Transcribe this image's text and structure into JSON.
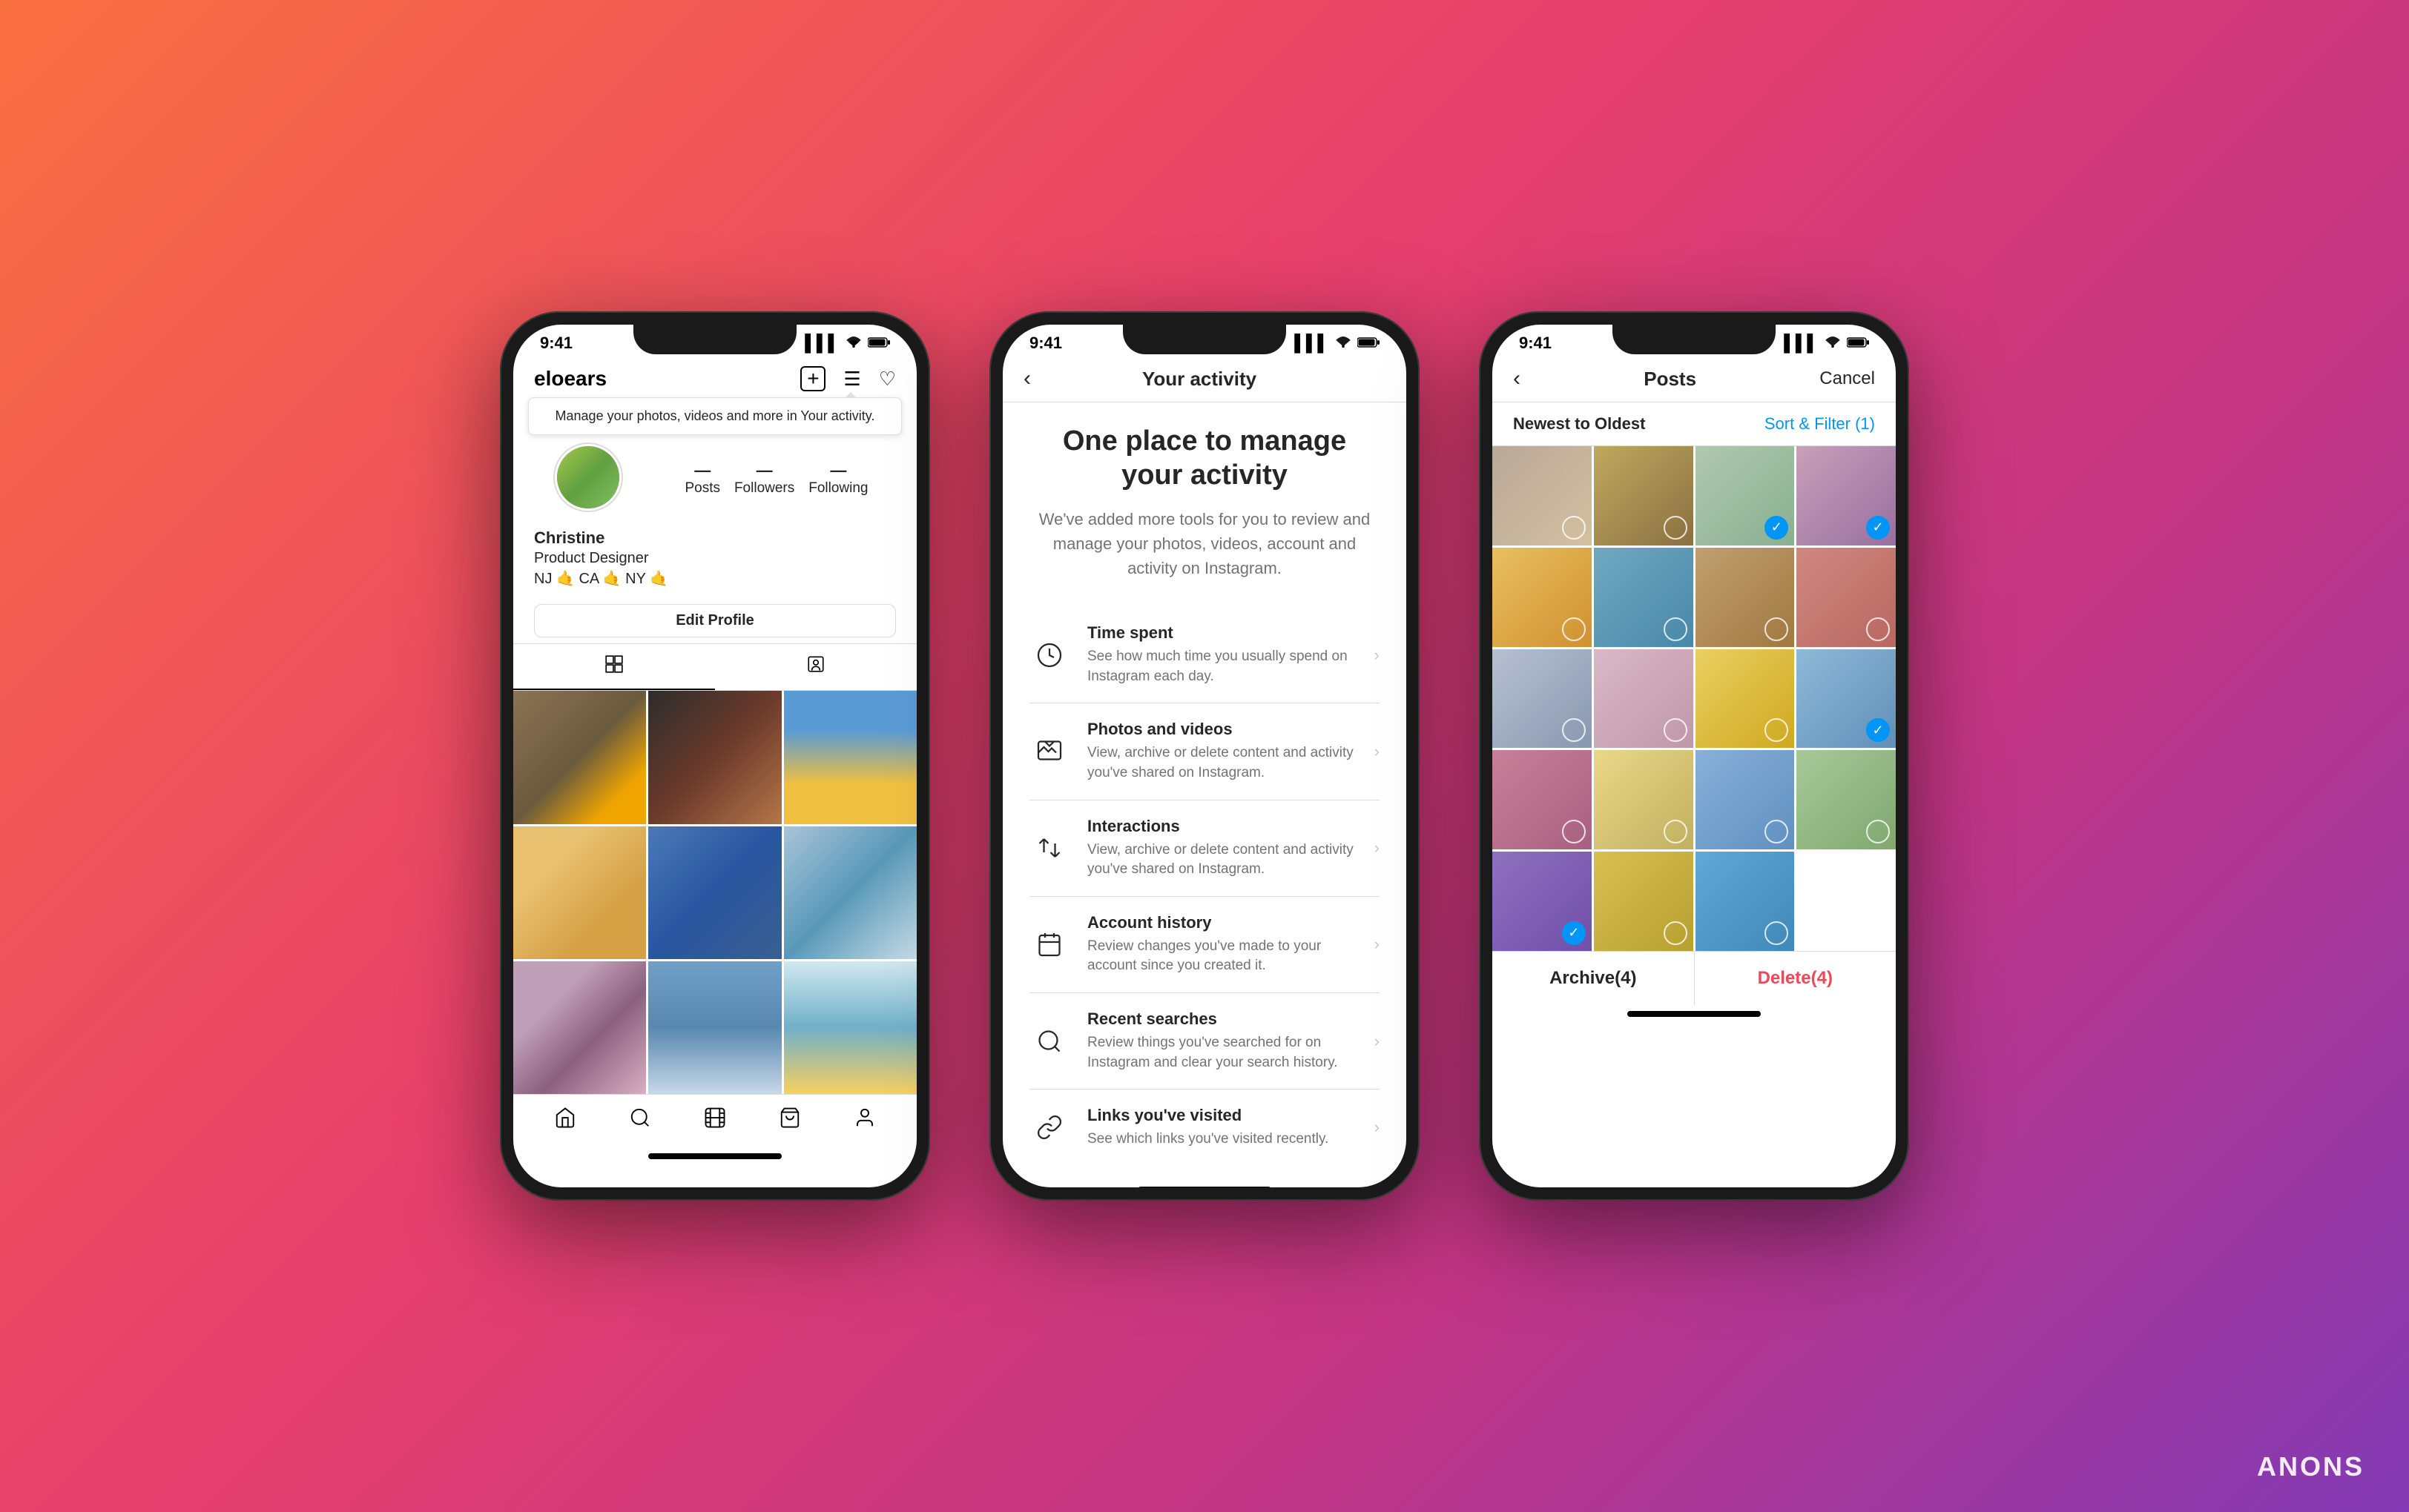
{
  "background": {
    "gradient": "linear-gradient(135deg, #f97040, #e8406c, #c13584, #833ab4)"
  },
  "watermark": {
    "text": "ANONS"
  },
  "phone1": {
    "status": {
      "time": "9:41",
      "signal": "●●●",
      "wifi": "wifi",
      "battery": "battery"
    },
    "header": {
      "username": "eloears",
      "add_icon": "+",
      "menu_icon": "☰",
      "heart_icon": "♡"
    },
    "tooltip": {
      "text": "Manage your photos, videos and more in Your activity."
    },
    "stats": {
      "posts_label": "Posts",
      "followers_label": "Followers",
      "following_label": "Following"
    },
    "profile": {
      "name": "Christine",
      "bio_line1": "Product Designer",
      "bio_line2": "NJ 🤙 CA 🤙 NY 🤙"
    },
    "edit_button": "Edit Profile",
    "tabs": {
      "grid_icon": "⊞",
      "tag_icon": "👤"
    },
    "bottom_nav": {
      "home": "🏠",
      "search": "🔍",
      "reels": "▶",
      "shop": "🛍",
      "profile": "👤"
    }
  },
  "phone2": {
    "status": {
      "time": "9:41"
    },
    "nav": {
      "back_icon": "‹",
      "title": "Your activity"
    },
    "hero": {
      "title": "One place to manage your activity",
      "subtitle": "We've added more tools for you to review and manage your photos, videos, account and activity on Instagram."
    },
    "items": [
      {
        "icon": "clock",
        "title": "Time spent",
        "description": "See how much time you usually spend on Instagram each day."
      },
      {
        "icon": "photos",
        "title": "Photos and videos",
        "description": "View, archive or delete content and activity you've shared on Instagram."
      },
      {
        "icon": "interactions",
        "title": "Interactions",
        "description": "View, archive or delete content and activity you've shared on Instagram."
      },
      {
        "icon": "calendar",
        "title": "Account history",
        "description": "Review changes you've made to your account since you created it."
      },
      {
        "icon": "search",
        "title": "Recent searches",
        "description": "Review things you've searched for on Instagram and clear your search history."
      },
      {
        "icon": "link",
        "title": "Links you've visited",
        "description": "See which links you've visited recently."
      }
    ]
  },
  "phone3": {
    "status": {
      "time": "9:41"
    },
    "nav": {
      "back_icon": "‹",
      "title": "Posts",
      "cancel": "Cancel"
    },
    "filter_bar": {
      "label": "Newest to Oldest",
      "filter_btn": "Sort & Filter (1)"
    },
    "posts": {
      "selected_count": 4
    },
    "bottom": {
      "archive_label": "Archive(4)",
      "delete_label": "Delete(4)"
    }
  }
}
